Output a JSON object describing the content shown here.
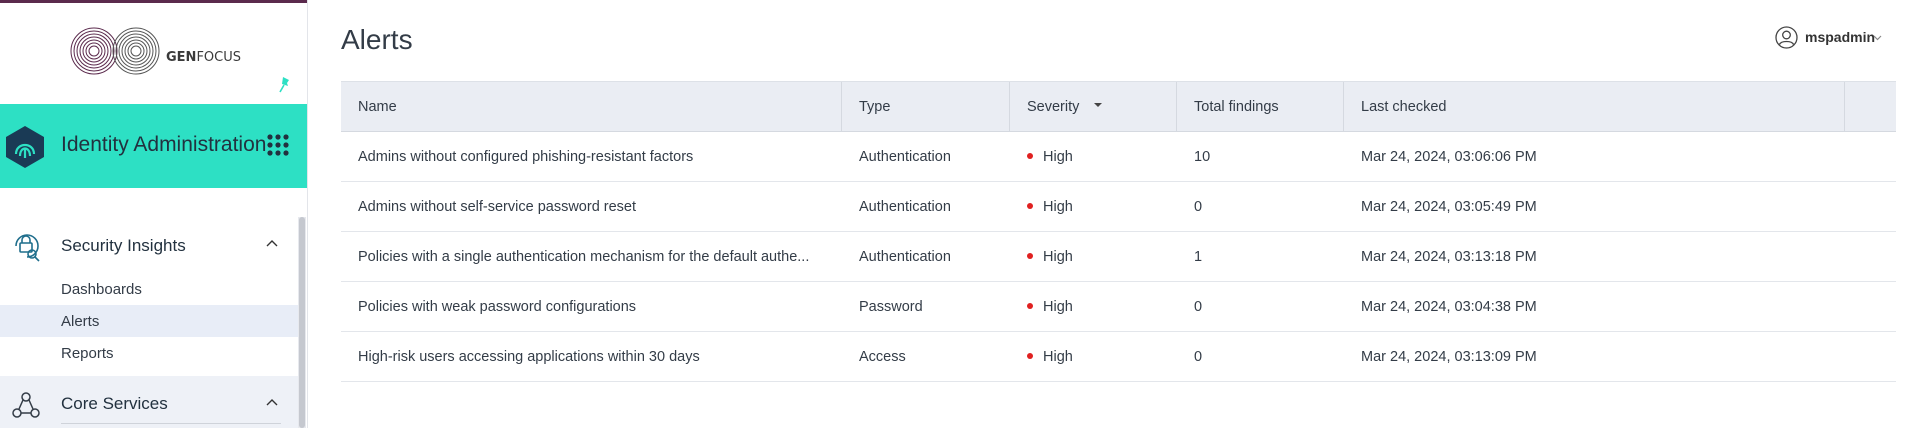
{
  "brand": {
    "logo_text_bold": "GEN",
    "logo_text_rest": "FOCUS"
  },
  "app": {
    "title": "Identity Administration",
    "accent": "#2de0c4"
  },
  "sidebar": {
    "sections": [
      {
        "label": "Security Insights",
        "items": [
          "Dashboards",
          "Alerts",
          "Reports"
        ],
        "active": "Alerts"
      },
      {
        "label": "Core Services"
      }
    ]
  },
  "page": {
    "title": "Alerts"
  },
  "user": {
    "name": "mspadmin"
  },
  "table": {
    "columns": [
      "Name",
      "Type",
      "Severity",
      "Total findings",
      "Last checked"
    ],
    "rows": [
      {
        "name": "Admins without configured phishing-resistant factors",
        "type": "Authentication",
        "severity": "High",
        "findings": "10",
        "checked": "Mar 24, 2024, 03:06:06 PM"
      },
      {
        "name": "Admins without self-service password reset",
        "type": "Authentication",
        "severity": "High",
        "findings": "0",
        "checked": "Mar 24, 2024, 03:05:49 PM"
      },
      {
        "name": "Policies with a single authentication mechanism for the default authe...",
        "type": "Authentication",
        "severity": "High",
        "findings": "1",
        "checked": "Mar 24, 2024, 03:13:18 PM"
      },
      {
        "name": "Policies with weak password configurations",
        "type": "Password",
        "severity": "High",
        "findings": "0",
        "checked": "Mar 24, 2024, 03:04:38 PM"
      },
      {
        "name": "High-risk users accessing applications within 30 days",
        "type": "Access",
        "severity": "High",
        "findings": "0",
        "checked": "Mar 24, 2024, 03:13:09 PM"
      }
    ],
    "severity_color": "#e02020"
  }
}
